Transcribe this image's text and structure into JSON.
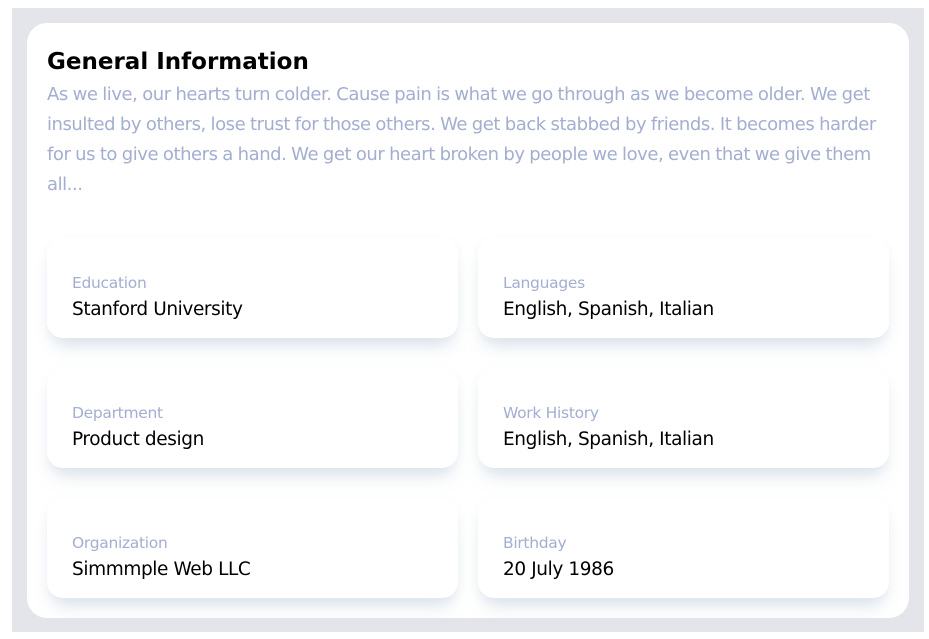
{
  "general_info": {
    "title": "General Information",
    "description": "As we live, our hearts turn colder. Cause pain is what we go through as we become older. We get insulted by others, lose trust for those others. We get back stabbed by friends. It becomes harder for us to give others a hand. We get our heart broken by people we love, even that we give them all...",
    "items": [
      {
        "label": "Education",
        "value": "Stanford University"
      },
      {
        "label": "Languages",
        "value": "English, Spanish, Italian"
      },
      {
        "label": "Department",
        "value": "Product design"
      },
      {
        "label": "Work History",
        "value": "English, Spanish, Italian"
      },
      {
        "label": "Organization",
        "value": "Simmmple Web LLC"
      },
      {
        "label": "Birthday",
        "value": "20 July 1986"
      }
    ]
  },
  "colors": {
    "page_background": "#e3e5ea",
    "card_background": "#ffffff",
    "muted_text": "#a3aed0",
    "primary_text": "#000000"
  }
}
